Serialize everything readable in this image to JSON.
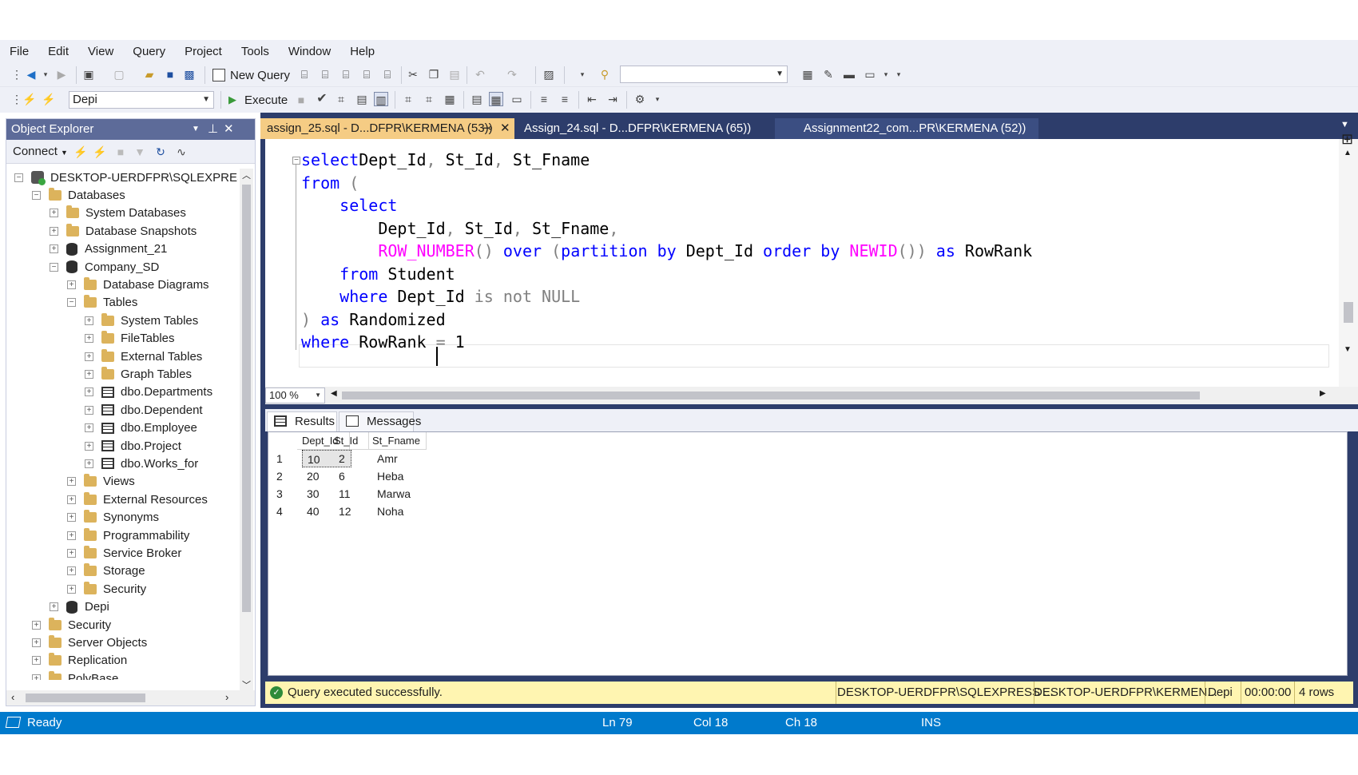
{
  "menu": [
    "File",
    "Edit",
    "View",
    "Query",
    "Project",
    "Tools",
    "Window",
    "Help"
  ],
  "toolbar": {
    "new_query_label": "New Query",
    "execute_label": "Execute",
    "database_select": "Depi",
    "solution_config": ""
  },
  "object_explorer": {
    "title": "Object Explorer",
    "connect_label": "Connect",
    "tree": [
      {
        "label": "DESKTOP-UERDFPR\\SQLEXPRESS (S",
        "icon": "server-icon",
        "level": 0,
        "expander": "−"
      },
      {
        "label": "Databases",
        "icon": "folder-icon",
        "level": 1,
        "expander": "−"
      },
      {
        "label": "System Databases",
        "icon": "folder-icon",
        "level": 2,
        "expander": "+"
      },
      {
        "label": "Database Snapshots",
        "icon": "folder-icon",
        "level": 2,
        "expander": "+"
      },
      {
        "label": "Assignment_21",
        "icon": "database-icon",
        "level": 2,
        "expander": "+"
      },
      {
        "label": "Company_SD",
        "icon": "database-icon",
        "level": 2,
        "expander": "−"
      },
      {
        "label": "Database Diagrams",
        "icon": "folder-icon",
        "level": 3,
        "expander": "+"
      },
      {
        "label": "Tables",
        "icon": "folder-icon",
        "level": 3,
        "expander": "−"
      },
      {
        "label": "System Tables",
        "icon": "folder-icon",
        "level": 4,
        "expander": "+"
      },
      {
        "label": "FileTables",
        "icon": "folder-icon",
        "level": 4,
        "expander": "+"
      },
      {
        "label": "External Tables",
        "icon": "folder-icon",
        "level": 4,
        "expander": "+"
      },
      {
        "label": "Graph Tables",
        "icon": "folder-icon",
        "level": 4,
        "expander": "+"
      },
      {
        "label": "dbo.Departments",
        "icon": "table-icon",
        "level": 4,
        "expander": "+"
      },
      {
        "label": "dbo.Dependent",
        "icon": "table-icon",
        "level": 4,
        "expander": "+"
      },
      {
        "label": "dbo.Employee",
        "icon": "table-icon",
        "level": 4,
        "expander": "+"
      },
      {
        "label": "dbo.Project",
        "icon": "table-icon",
        "level": 4,
        "expander": "+"
      },
      {
        "label": "dbo.Works_for",
        "icon": "table-icon",
        "level": 4,
        "expander": "+"
      },
      {
        "label": "Views",
        "icon": "folder-icon",
        "level": 3,
        "expander": "+"
      },
      {
        "label": "External Resources",
        "icon": "folder-icon",
        "level": 3,
        "expander": "+"
      },
      {
        "label": "Synonyms",
        "icon": "folder-icon",
        "level": 3,
        "expander": "+"
      },
      {
        "label": "Programmability",
        "icon": "folder-icon",
        "level": 3,
        "expander": "+"
      },
      {
        "label": "Service Broker",
        "icon": "folder-icon",
        "level": 3,
        "expander": "+"
      },
      {
        "label": "Storage",
        "icon": "folder-icon",
        "level": 3,
        "expander": "+"
      },
      {
        "label": "Security",
        "icon": "folder-icon",
        "level": 3,
        "expander": "+"
      },
      {
        "label": "Depi",
        "icon": "database-icon",
        "level": 2,
        "expander": "+"
      },
      {
        "label": "Security",
        "icon": "folder-icon",
        "level": 1,
        "expander": "+"
      },
      {
        "label": "Server Objects",
        "icon": "folder-icon",
        "level": 1,
        "expander": "+"
      },
      {
        "label": "Replication",
        "icon": "folder-icon",
        "level": 1,
        "expander": "+"
      },
      {
        "label": "PolyBase",
        "icon": "folder-icon",
        "level": 1,
        "expander": "+"
      }
    ]
  },
  "tabs": [
    {
      "label": "assign_25.sql - D...DFPR\\KERMENA (53))",
      "active": true,
      "pin": "⊸",
      "close": "✕"
    },
    {
      "label": "Assign_24.sql - D...DFPR\\KERMENA (65))",
      "active": false
    },
    {
      "label": "Assignment22_com...PR\\KERMENA (52))",
      "active": false
    }
  ],
  "editor": {
    "lines": [
      [
        [
          "kw",
          "select"
        ],
        [
          "",
          "Dept_Id"
        ],
        [
          "gr",
          ","
        ],
        [
          "",
          " St_Id"
        ],
        [
          "gr",
          ","
        ],
        [
          "",
          " St_Fname"
        ]
      ],
      [
        [
          "kw",
          "from"
        ],
        [
          "gr",
          " ("
        ]
      ],
      [
        [
          "",
          "    "
        ],
        [
          "kw",
          "select"
        ]
      ],
      [
        [
          "",
          "        Dept_Id"
        ],
        [
          "gr",
          ","
        ],
        [
          "",
          " St_Id"
        ],
        [
          "gr",
          ","
        ],
        [
          "",
          " St_Fname"
        ],
        [
          "gr",
          ","
        ]
      ],
      [
        [
          "",
          "        "
        ],
        [
          "fn",
          "ROW_NUMBER"
        ],
        [
          "gr",
          "()"
        ],
        [
          "kw",
          " over"
        ],
        [
          "gr",
          " ("
        ],
        [
          "kw",
          "partition by"
        ],
        [
          "",
          " Dept_Id "
        ],
        [
          "kw",
          "order by"
        ],
        [
          "fn",
          " NEWID"
        ],
        [
          "gr",
          "())"
        ],
        [
          "kw",
          " as"
        ],
        [
          "",
          " RowRank"
        ]
      ],
      [
        [
          "",
          "    "
        ],
        [
          "kw",
          "from"
        ],
        [
          "",
          " Student"
        ]
      ],
      [
        [
          "",
          "    "
        ],
        [
          "kw",
          "where"
        ],
        [
          "",
          " Dept_Id "
        ],
        [
          "gr",
          "is not NULL"
        ]
      ],
      [
        [
          "gr",
          ")"
        ],
        [
          "kw",
          " as"
        ],
        [
          "",
          " Randomized"
        ]
      ],
      [
        [
          "kw",
          "where"
        ],
        [
          "",
          " RowRank "
        ],
        [
          "gr",
          "="
        ],
        [
          "",
          " 1"
        ]
      ]
    ],
    "zoom": "100 %"
  },
  "results": {
    "tabs": [
      "Results",
      "Messages"
    ],
    "columns": [
      "Dept_Id",
      "St_Id",
      "St_Fname"
    ],
    "rows": [
      [
        "1",
        "10",
        "2",
        "Amr"
      ],
      [
        "2",
        "20",
        "6",
        "Heba"
      ],
      [
        "3",
        "30",
        "11",
        "Marwa"
      ],
      [
        "4",
        "40",
        "12",
        "Noha"
      ]
    ]
  },
  "query_status": {
    "message": "Query executed successfully.",
    "server": "DESKTOP-UERDFPR\\SQLEXPRESS ...",
    "user": "DESKTOP-UERDFPR\\KERMEN...",
    "database": "Depi",
    "elapsed": "00:00:00",
    "rows": "4 rows"
  },
  "statusbar": {
    "ready": "Ready",
    "ln": "Ln 79",
    "col": "Col 18",
    "ch": "Ch 18",
    "mode": "INS"
  },
  "colors": {
    "keyword": "#0000ff",
    "function": "#ff00ff",
    "operator": "#808080",
    "statusbar": "#007acc",
    "panel_title": "#5d6b99",
    "query_status_bg": "#fff5b1"
  }
}
